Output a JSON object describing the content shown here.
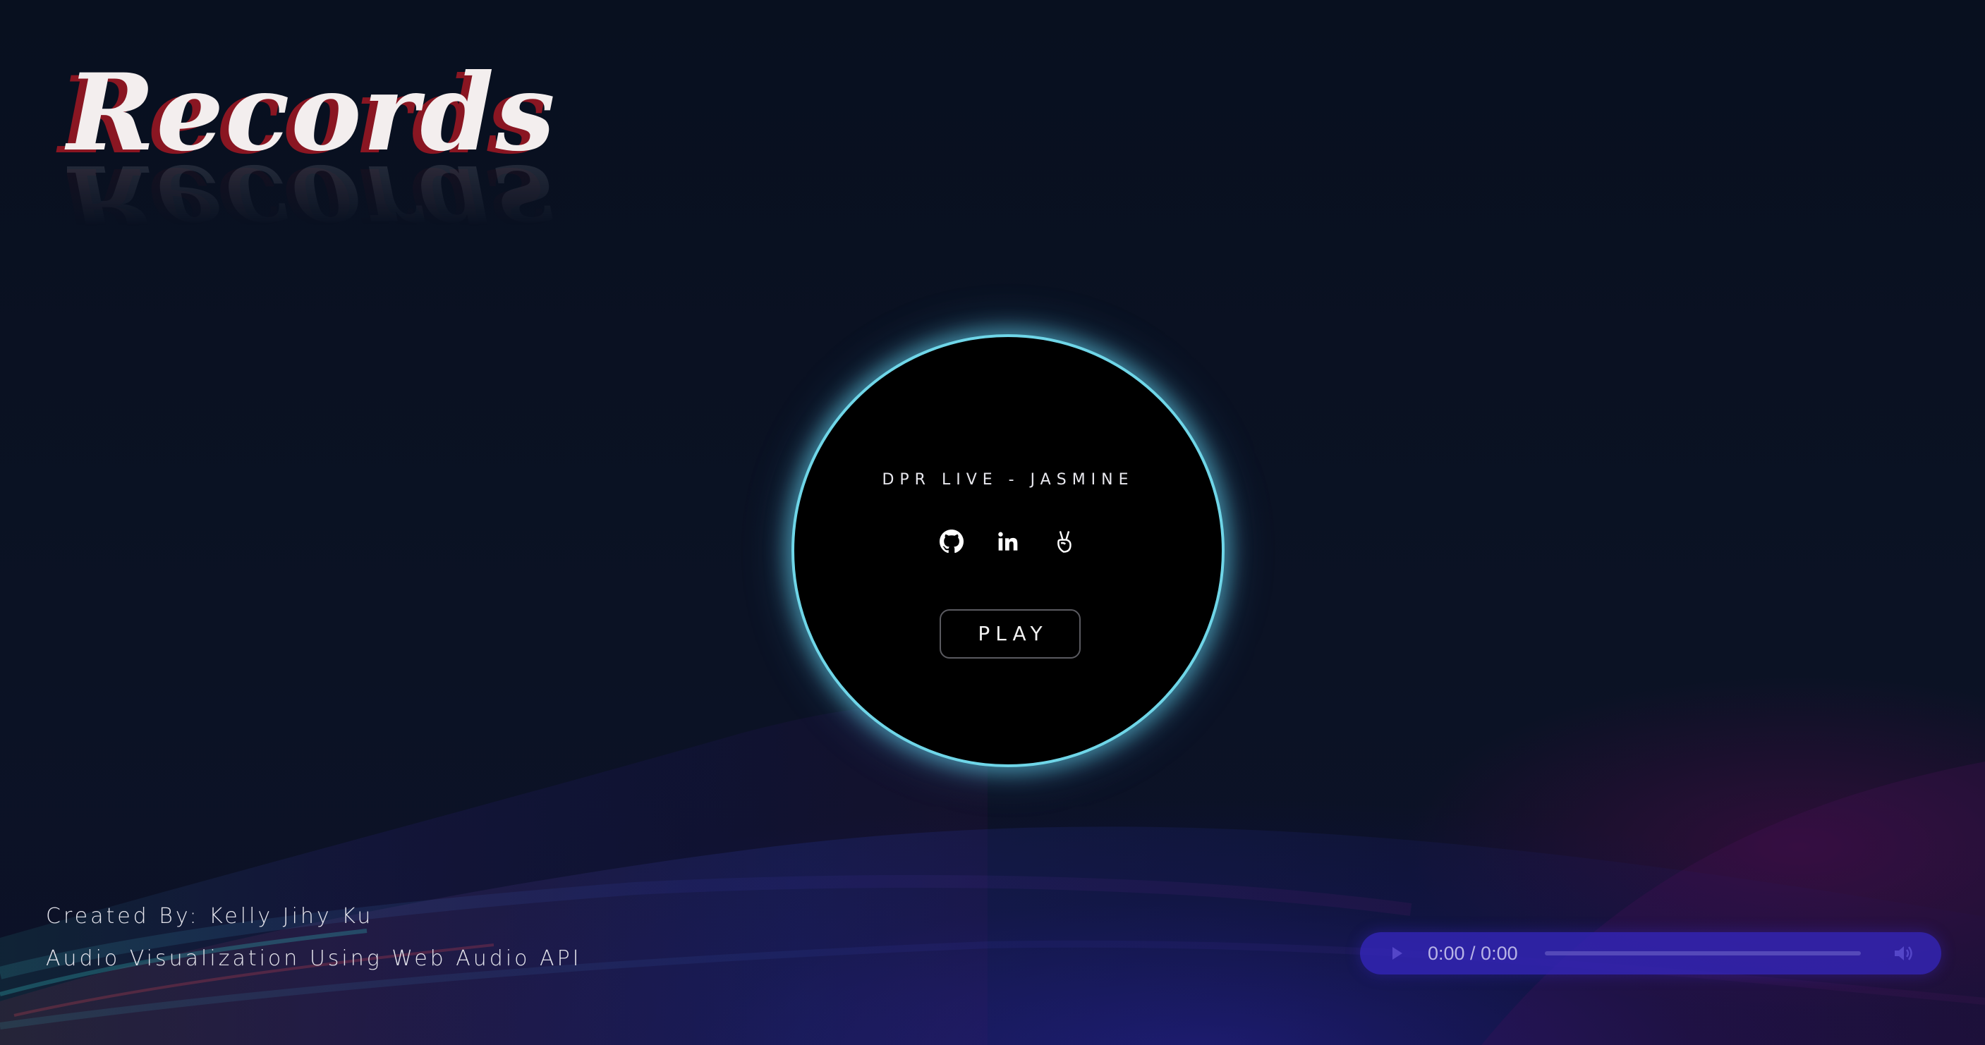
{
  "logo": {
    "text": "Records",
    "reflection_text": "Records"
  },
  "player_disc": {
    "track_title": "DPR LIVE - JASMINE",
    "icons": [
      "github-icon",
      "linkedin-icon",
      "angellist-icon"
    ],
    "play_label": "PLAY",
    "glow_color": "#6fd6e8"
  },
  "credits": {
    "created_by": "Created By: Kelly Jihy Ku",
    "subtitle": "Audio Visualization Using Web Audio API"
  },
  "audio_controls": {
    "time_display": "0:00 / 0:00",
    "progress": 0,
    "play_icon": "play-icon",
    "volume_icon": "volume-icon",
    "background_color": "#3426be"
  },
  "colors": {
    "background": "#0a1020",
    "logo_text": "#f3eeee",
    "logo_shadow": "#8a1622",
    "disc_border": "#6fd6e8"
  }
}
